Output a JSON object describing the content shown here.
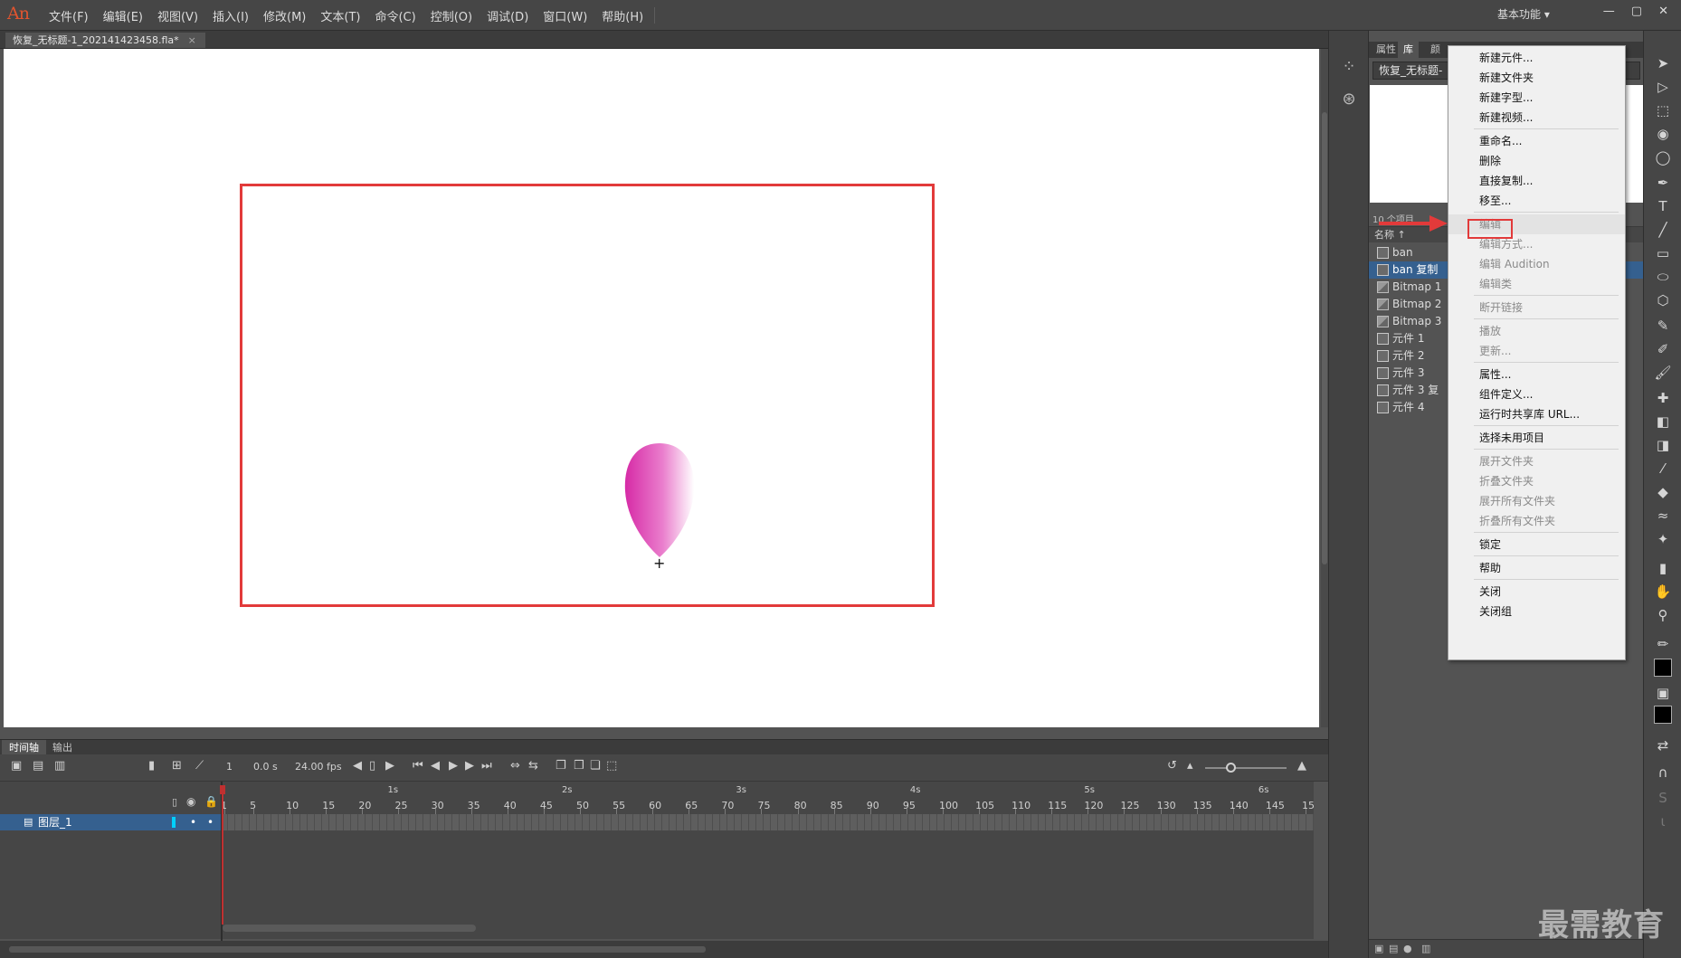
{
  "app": {
    "logo": "An",
    "workspace": "基本功能 ▾",
    "win_controls": [
      "—",
      "▢",
      "✕"
    ]
  },
  "menu": [
    {
      "label": "文件(F)"
    },
    {
      "label": "编辑(E)"
    },
    {
      "label": "视图(V)"
    },
    {
      "label": "插入(I)"
    },
    {
      "label": "修改(M)"
    },
    {
      "label": "文本(T)"
    },
    {
      "label": "命令(C)"
    },
    {
      "label": "控制(O)"
    },
    {
      "label": "调试(D)"
    },
    {
      "label": "窗口(W)"
    },
    {
      "label": "帮助(H)"
    }
  ],
  "document": {
    "tab_title": "恢复_无标题-1_202141423458.fla*",
    "close": "×"
  },
  "stage": {
    "registration_mark": "+",
    "highlight_color": "#e23a3a",
    "petal_colors": [
      "#d62aa6",
      "#ffffff"
    ]
  },
  "library": {
    "tabs": [
      "属性",
      "库",
      "颜"
    ],
    "active_tab": "库",
    "document_select": "恢复_无标题-",
    "item_count": "10 个项目",
    "column_name": "名称 ↑",
    "items": [
      {
        "name": "ban",
        "type": "symbol"
      },
      {
        "name": "ban 复制",
        "type": "symbol",
        "selected": true
      },
      {
        "name": "Bitmap 1",
        "type": "bitmap"
      },
      {
        "name": "Bitmap 2",
        "type": "bitmap"
      },
      {
        "name": "Bitmap 3",
        "type": "bitmap"
      },
      {
        "name": "元件 1",
        "type": "symbol"
      },
      {
        "name": "元件 2",
        "type": "symbol"
      },
      {
        "name": "元件 3",
        "type": "symbol"
      },
      {
        "name": "元件 3 复",
        "type": "symbol"
      },
      {
        "name": "元件 4",
        "type": "symbol"
      }
    ]
  },
  "context_menu": {
    "items": [
      {
        "label": "新建元件...",
        "disabled": false
      },
      {
        "label": "新建文件夹",
        "disabled": false
      },
      {
        "label": "新建字型...",
        "disabled": false
      },
      {
        "label": "新建视频...",
        "disabled": false
      },
      {
        "sep": true
      },
      {
        "label": "重命名...",
        "disabled": false
      },
      {
        "label": "删除",
        "disabled": false
      },
      {
        "label": "直接复制...",
        "disabled": false
      },
      {
        "label": "移至...",
        "disabled": false
      },
      {
        "sep": true
      },
      {
        "label": "编辑",
        "disabled": true,
        "highlighted": true
      },
      {
        "label": "编辑方式...",
        "disabled": true
      },
      {
        "label": "编辑 Audition",
        "disabled": true
      },
      {
        "label": "编辑类",
        "disabled": true
      },
      {
        "sep": true
      },
      {
        "label": "断开链接",
        "disabled": true
      },
      {
        "sep": true
      },
      {
        "label": "播放",
        "disabled": true
      },
      {
        "label": "更新...",
        "disabled": true
      },
      {
        "sep": true
      },
      {
        "label": "属性...",
        "disabled": false
      },
      {
        "label": "组件定义...",
        "disabled": false
      },
      {
        "label": "运行时共享库 URL...",
        "disabled": false
      },
      {
        "sep": true
      },
      {
        "label": "选择未用项目",
        "disabled": false
      },
      {
        "sep": true
      },
      {
        "label": "展开文件夹",
        "disabled": true
      },
      {
        "label": "折叠文件夹",
        "disabled": true
      },
      {
        "label": "展开所有文件夹",
        "disabled": true
      },
      {
        "label": "折叠所有文件夹",
        "disabled": true
      },
      {
        "sep": true
      },
      {
        "label": "锁定",
        "disabled": false
      },
      {
        "sep": true
      },
      {
        "label": "帮助",
        "disabled": false
      },
      {
        "sep": true
      },
      {
        "label": "关闭",
        "disabled": false
      },
      {
        "label": "关闭组",
        "disabled": false
      }
    ]
  },
  "timeline": {
    "tabs": [
      "时间轴",
      "输出"
    ],
    "active_tab": "时间轴",
    "current_frame": "1",
    "time": "0.0 s",
    "fps": "24.00 fps",
    "layer_name": "图层_1",
    "seconds": [
      "1s",
      "2s",
      "3s",
      "4s",
      "5s",
      "6s"
    ],
    "frame_numbers": [
      "1",
      "5",
      "10",
      "15",
      "20",
      "25",
      "30",
      "35",
      "40",
      "45",
      "50",
      "55",
      "60",
      "65",
      "70",
      "75",
      "80",
      "85",
      "90",
      "95",
      "100",
      "105",
      "110",
      "115",
      "120",
      "125",
      "130",
      "135",
      "140",
      "145",
      "15"
    ]
  },
  "watermark": "最需教育"
}
